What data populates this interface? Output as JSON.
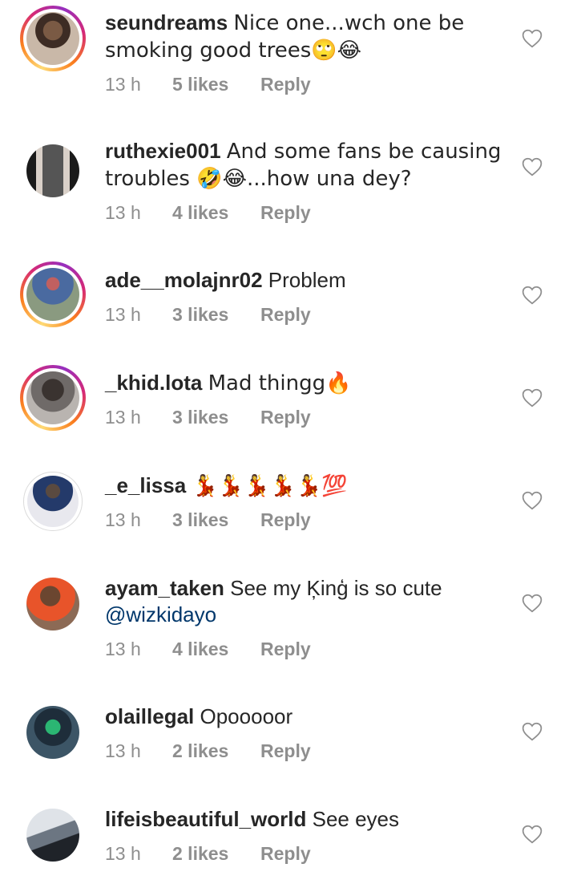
{
  "comments": [
    {
      "user": "seundreams",
      "text": "Nice one...wch one be smoking good trees🙄😂",
      "mention": "",
      "time": "13 h",
      "likes": "5 likes",
      "reply": "Reply",
      "story": true
    },
    {
      "user": "ruthexie001",
      "text": "And some fans be causing troubles 🤣😂...how una dey?",
      "mention": "",
      "time": "13 h",
      "likes": "4 likes",
      "reply": "Reply",
      "story": false
    },
    {
      "user": "ade__molajnr02",
      "text": "Problem",
      "mention": "",
      "time": "13 h",
      "likes": "3 likes",
      "reply": "Reply",
      "story": true
    },
    {
      "user": "_khid.lota",
      "text": "Mad thingg🔥",
      "mention": "",
      "time": "13 h",
      "likes": "3 likes",
      "reply": "Reply",
      "story": true
    },
    {
      "user": "_e_lissa",
      "text": "💃💃💃💃💃💯",
      "mention": "",
      "time": "13 h",
      "likes": "3 likes",
      "reply": "Reply",
      "story": false
    },
    {
      "user": "ayam_taken",
      "text": "See my Ķinģ is so cute",
      "mention": "@wizkidayo",
      "time": "13 h",
      "likes": "4 likes",
      "reply": "Reply",
      "story": false
    },
    {
      "user": "olaillegal",
      "text": "Opooooor",
      "mention": "",
      "time": "13 h",
      "likes": "2 likes",
      "reply": "Reply",
      "story": false
    },
    {
      "user": "lifeisbeautiful_world",
      "text": "See eyes",
      "mention": "",
      "time": "13 h",
      "likes": "2 likes",
      "reply": "Reply",
      "story": false
    }
  ],
  "colors": {
    "text": "#262626",
    "meta": "#8e8e8e",
    "mention": "#00376b"
  },
  "icons": {
    "like": "heart-outline-icon",
    "avatar": "user-avatar"
  }
}
